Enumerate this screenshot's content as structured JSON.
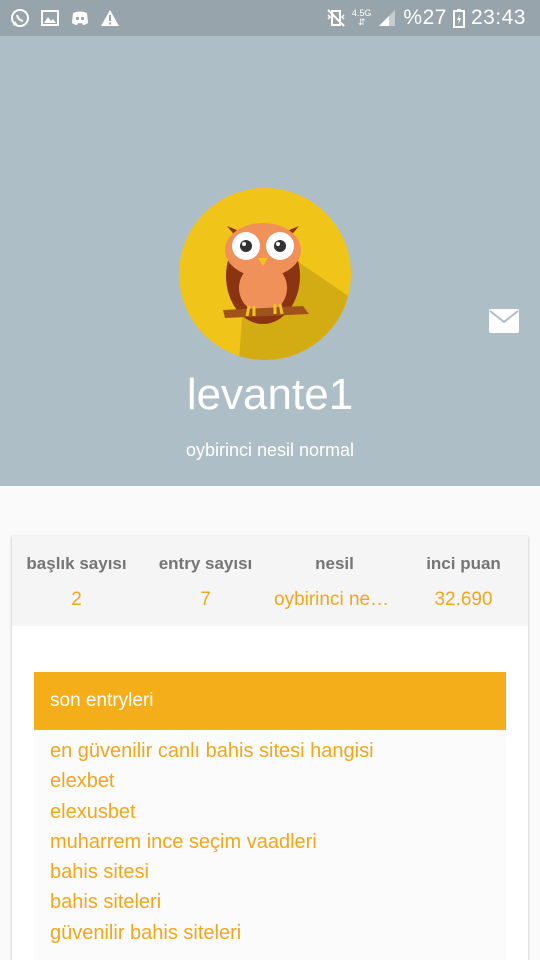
{
  "status_bar": {
    "icons_left": [
      "whatsapp-icon",
      "image-icon",
      "discord-icon",
      "warning-icon"
    ],
    "network_label": "4.5G",
    "battery": "%27",
    "time": "23:43"
  },
  "profile": {
    "username": "levante1",
    "title": "oybirinci nesil normal",
    "avatar_icon": "owl-avatar",
    "message_icon": "mail-icon"
  },
  "stats": [
    {
      "label": "başlık sayısı",
      "value": "2"
    },
    {
      "label": "entry sayısı",
      "value": "7"
    },
    {
      "label": "nesil",
      "value": "oybirinci nesil normal"
    },
    {
      "label": "inci puan",
      "value": "32.690"
    }
  ],
  "entries": {
    "header": "son entryleri",
    "items": [
      "en güvenilir canlı bahis sitesi hangisi",
      "elexbet",
      "elexusbet",
      "muharrem ince seçim vaadleri",
      "bahis sitesi",
      "bahis siteleri",
      "güvenilir bahis siteleri"
    ]
  },
  "colors": {
    "accent": "#f4ae1a",
    "header_bg": "#aebec6",
    "status_bar_bg": "#97a4ab",
    "avatar_bg": "#f0c419"
  }
}
